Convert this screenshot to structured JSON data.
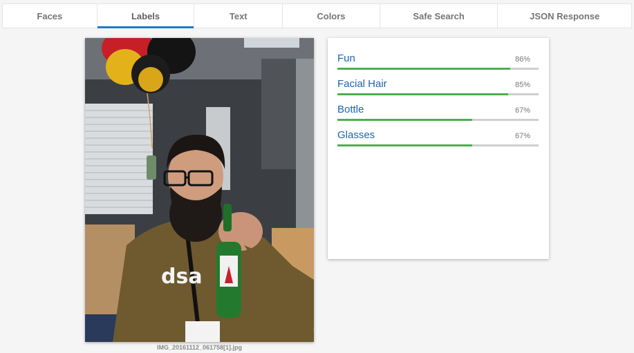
{
  "tabs": [
    {
      "label": "Faces"
    },
    {
      "label": "Labels"
    },
    {
      "label": "Text"
    },
    {
      "label": "Colors"
    },
    {
      "label": "Safe Search"
    },
    {
      "label": "JSON Response"
    }
  ],
  "active_tab": "Labels",
  "image": {
    "filename": "IMG_20161112_061758[1].jpg"
  },
  "labels": [
    {
      "name": "Fun",
      "score_text": "86%",
      "score": 0.86
    },
    {
      "name": "Facial Hair",
      "score_text": "85%",
      "score": 0.85
    },
    {
      "name": "Bottle",
      "score_text": "67%",
      "score": 0.67
    },
    {
      "name": "Glasses",
      "score_text": "67%",
      "score": 0.67
    }
  ],
  "colors": {
    "accent": "#1e7bc8",
    "label_text": "#1e64ae",
    "bar_fill": "#4caf50",
    "bar_track": "#cfcfcf"
  }
}
